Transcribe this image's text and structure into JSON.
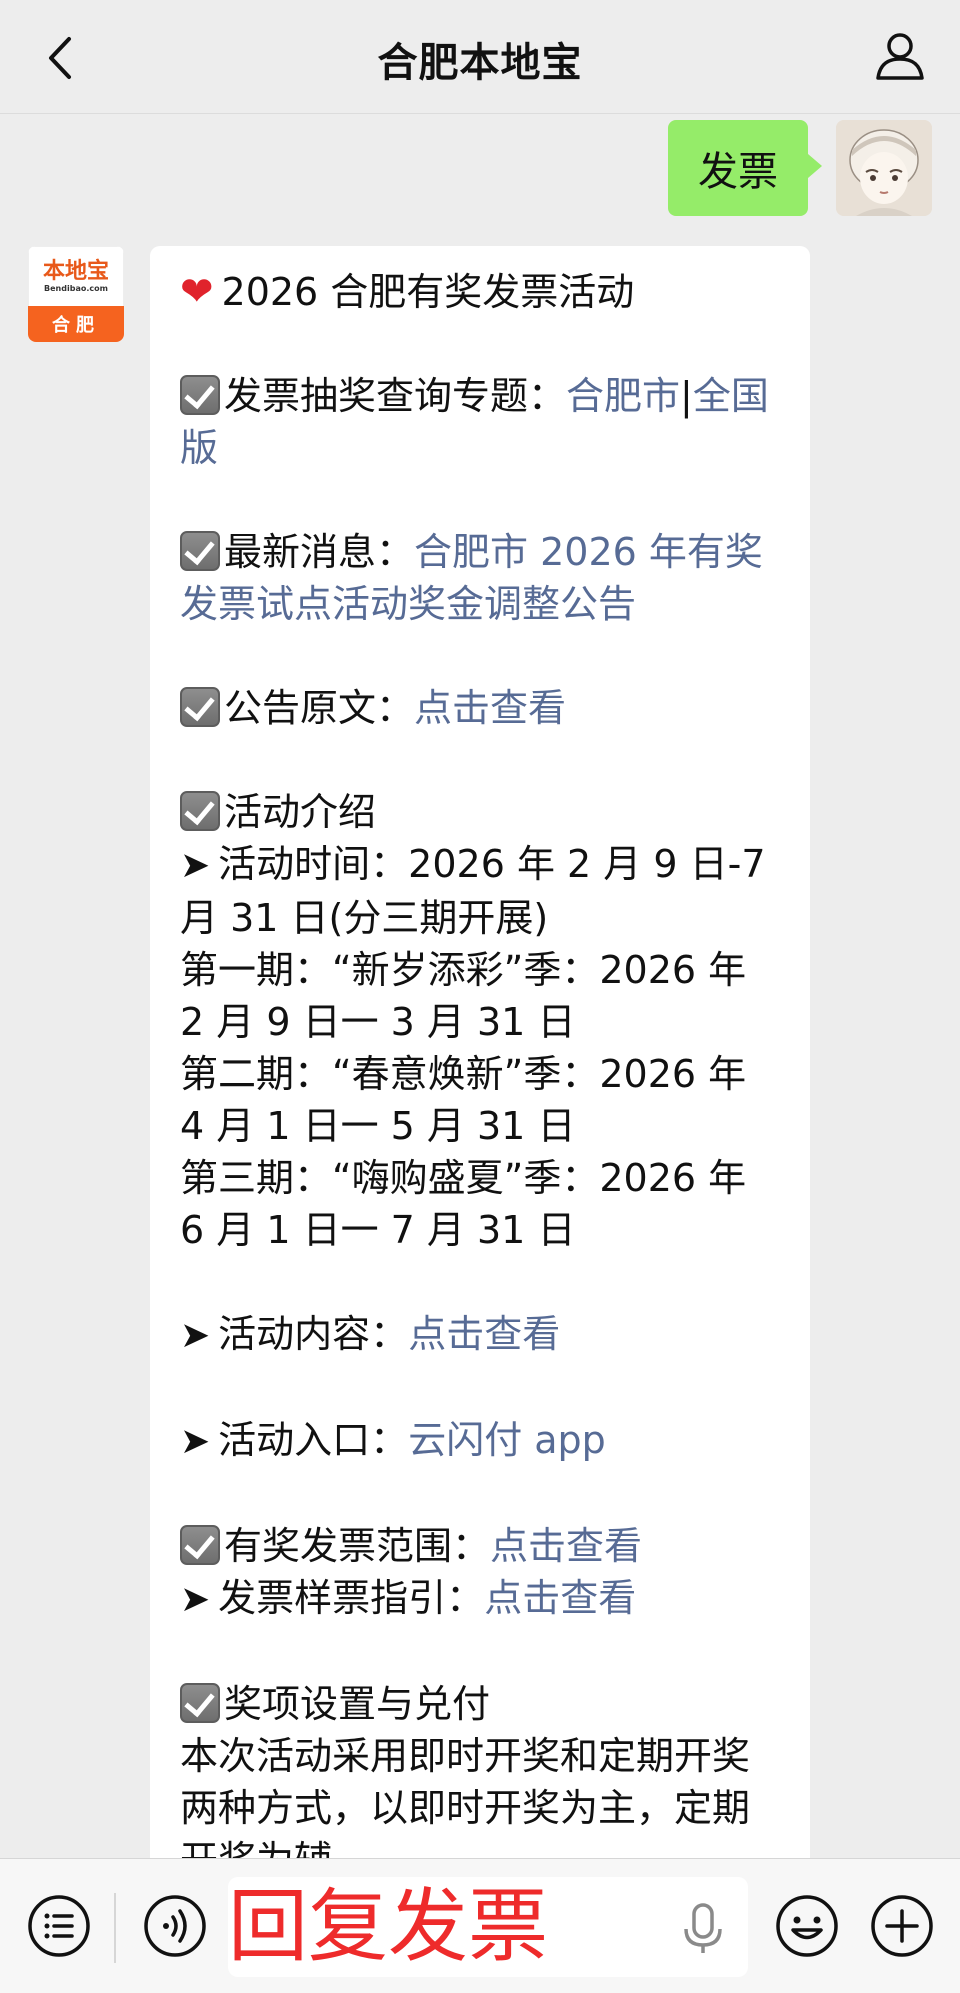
{
  "header": {
    "title": "合肥本地宝"
  },
  "outgoing": {
    "text": "发票"
  },
  "account_logo": {
    "brand_cn": "本地宝",
    "brand_en": "Bendibao.com",
    "city": "合肥"
  },
  "message": {
    "headline": "2026 合肥有奖发票活动",
    "query_label": "发票抽奖查询专题：",
    "query_link_city": "合肥市",
    "query_sep": "|",
    "query_link_national": "全国版",
    "news_label": "最新消息：",
    "news_link": "合肥市 2026 年有奖发票试点活动奖金调整公告",
    "notice_label": "公告原文：",
    "notice_link": "点击查看",
    "intro_label": "活动介绍",
    "time_label": "活动时间：2026 年 2 月 9 日-7 月 31 日(分三期开展)",
    "phase1": "第一期：“新岁添彩”季：2026 年 2 月 9 日一 3 月 31 日",
    "phase2": "第二期：“春意焕新”季：2026 年 4 月 1 日一 5 月 31 日",
    "phase3": "第三期：“嗨购盛夏”季：2026 年 6 月 1 日一 7 月 31 日",
    "content_label": "活动内容：",
    "content_link": "点击查看",
    "entry_label": "活动入口：",
    "entry_link": "云闪付 app",
    "scope_label": "有奖发票范围：",
    "scope_link": "点击查看",
    "sample_label": "发票样票指引：",
    "sample_link": "点击查看",
    "prize_label": "奖项设置与兑付",
    "prize_text": "本次活动采用即时开奖和定期开奖两种方式，以即时开奖为主，定期开奖为辅"
  },
  "bottom": {
    "input_text": "回复发票"
  },
  "icons": {
    "back": "chevron-left-icon",
    "profile": "person-icon",
    "menu": "list-icon",
    "voice": "voice-icon",
    "mic": "mic-icon",
    "emoji": "emoji-icon",
    "plus": "plus-icon"
  },
  "colors": {
    "bubble_out": "#95ec69",
    "link": "#576b95",
    "input_text": "#ee2b2b",
    "brand_orange": "#f5631f"
  }
}
